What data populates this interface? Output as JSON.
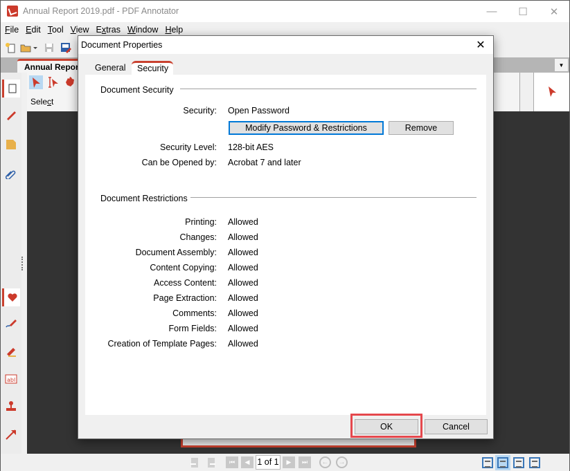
{
  "window": {
    "title": "Annual Report 2019.pdf - PDF Annotator",
    "controls": {
      "minimize": "—",
      "maximize": "☐",
      "close": "✕"
    }
  },
  "menu": [
    {
      "label": "File",
      "ul": "F",
      "rest": "ile"
    },
    {
      "label": "Edit",
      "ul": "E",
      "rest": "dit"
    },
    {
      "label": "Tool",
      "ul": "T",
      "rest": "ool"
    },
    {
      "label": "View",
      "ul": "V",
      "rest": "iew"
    },
    {
      "label": "Extras",
      "pre": "E",
      "ul": "x",
      "rest": "tras"
    },
    {
      "label": "Window",
      "ul": "W",
      "rest": "indow"
    },
    {
      "label": "Help",
      "ul": "H",
      "rest": "elp"
    }
  ],
  "toolbar": {
    "icons": [
      "new-document-icon",
      "open-folder-icon",
      "dropdown-arrow-icon",
      "save-icon",
      "save-annotations-icon"
    ]
  },
  "document_tab": {
    "label": "Annual Report"
  },
  "tool_panel": {
    "label_pre": "Sele",
    "label_ul": "c",
    "label_post": "t",
    "tools": [
      "select-arrow-icon",
      "text-select-icon",
      "hand-icon"
    ]
  },
  "left_rail": {
    "icons": [
      "page-icon",
      "pen-icon",
      "note-icon",
      "paperclip-icon",
      "heart-icon",
      "freehand-pen-icon",
      "highlighter-icon",
      "text-field-icon",
      "stamp-icon",
      "arrow-icon"
    ]
  },
  "statusbar": {
    "page_display": "1 of 1",
    "nav": [
      "first-page",
      "previous-page",
      "next-page",
      "last-page"
    ],
    "history": [
      "back",
      "forward"
    ],
    "layouts": [
      "single-page",
      "continuous",
      "two-page",
      "two-page-continuous"
    ],
    "active_layout": "continuous"
  },
  "dialog": {
    "title": "Document Properties",
    "close": "✕",
    "tabs": [
      {
        "label": "General",
        "active": false
      },
      {
        "label": "Security",
        "active": true
      }
    ],
    "security_section": {
      "title": "Document Security",
      "security_label": "Security:",
      "security_value": "Open Password",
      "modify_button": "Modify Password & Restrictions",
      "remove_button": "Remove",
      "level_label": "Security Level:",
      "level_value": "128-bit AES",
      "opened_label": "Can be Opened by:",
      "opened_value": "Acrobat 7 and later"
    },
    "restrictions_section": {
      "title": "Document Restrictions",
      "items": [
        {
          "label": "Printing:",
          "value": "Allowed"
        },
        {
          "label": "Changes:",
          "value": "Allowed"
        },
        {
          "label": "Document Assembly:",
          "value": "Allowed"
        },
        {
          "label": "Content Copying:",
          "value": "Allowed"
        },
        {
          "label": "Access Content:",
          "value": "Allowed"
        },
        {
          "label": "Page Extraction:",
          "value": "Allowed"
        },
        {
          "label": "Comments:",
          "value": "Allowed"
        },
        {
          "label": "Form Fields:",
          "value": "Allowed"
        },
        {
          "label": "Creation of Template Pages:",
          "value": "Allowed"
        }
      ]
    },
    "ok_button": "OK",
    "cancel_button": "Cancel"
  },
  "colors": {
    "accent_red": "#c9412f",
    "highlight_red": "#e5484d",
    "focus_blue": "#0078d7",
    "selected_blue": "#b8d8f2",
    "document_background": "#333333"
  }
}
